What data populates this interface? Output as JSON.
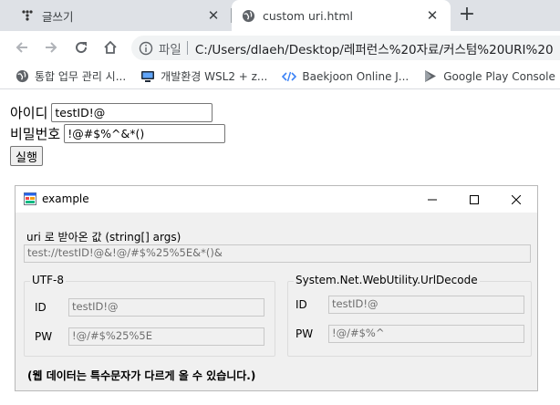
{
  "browser": {
    "tabs": [
      {
        "title": "글쓰기",
        "icon": "dots-logo-icon",
        "active": false
      },
      {
        "title": "custom uri.html",
        "icon": "globe-icon",
        "active": true
      }
    ],
    "address": {
      "scheme_label": "파일",
      "url": "C:/Users/dlaeh/Desktop/레퍼런스%20자료/커스텀%20URI%20"
    },
    "bookmarks": [
      {
        "label": "통합 업무 관리 시...",
        "icon": "globe-icon"
      },
      {
        "label": "개발환경 WSL2 + z...",
        "icon": "monitor-icon"
      },
      {
        "label": "Baekjoon Online J...",
        "icon": "code-brackets-icon"
      },
      {
        "label": "Google Play Console",
        "icon": "play-console-icon"
      }
    ]
  },
  "form": {
    "id_label": "아이디",
    "id_value": "testID!@",
    "pw_label": "비밀번호",
    "pw_value": "!@#$%^&*()",
    "submit_label": "실행"
  },
  "app_window": {
    "title": "example",
    "uri_label": "uri 로 받아온 값 (string[] args)",
    "uri_value": "test://testID!@&!@/#$%25%5E&*()&",
    "utf8_group": {
      "title": "UTF-8",
      "id_label": "ID",
      "id_value": "testID!@",
      "pw_label": "PW",
      "pw_value": "!@/#$%25%5E"
    },
    "decode_group": {
      "title": "System.Net.WebUtility.UrlDecode",
      "id_label": "ID",
      "id_value": "testID!@",
      "pw_label": "PW",
      "pw_value": "!@/#$%^"
    },
    "note": "(웹 데이터는 특수문자가 다르게 올 수 있습니다.)"
  }
}
